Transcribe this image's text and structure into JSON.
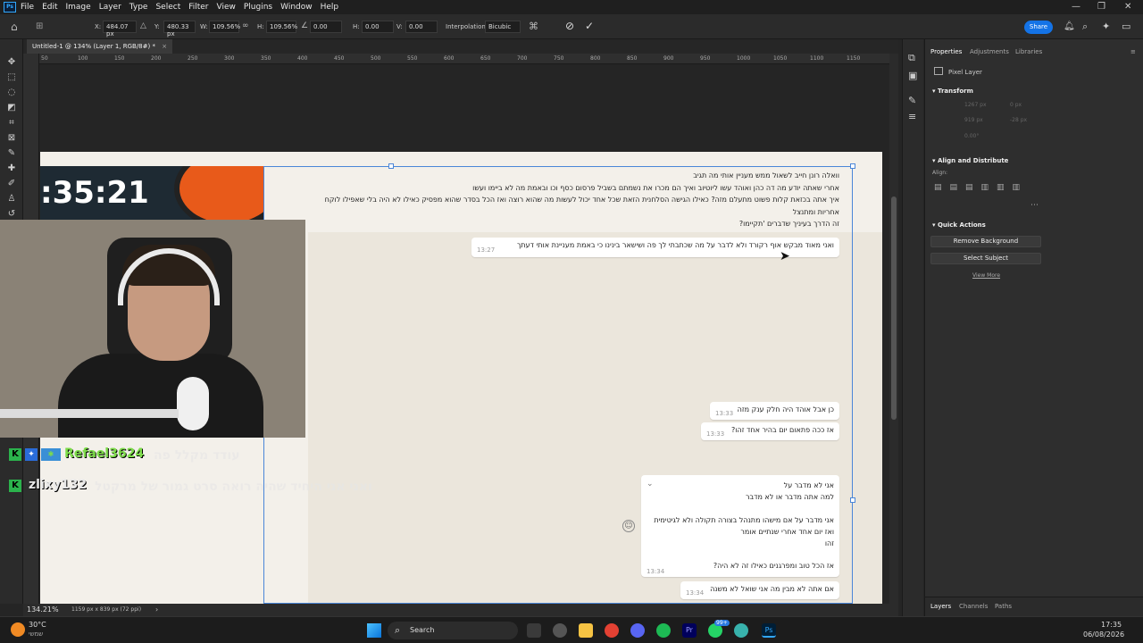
{
  "menubar": {
    "logo": "Ps",
    "items": [
      "File",
      "Edit",
      "Image",
      "Layer",
      "Type",
      "Select",
      "Filter",
      "View",
      "Plugins",
      "Window",
      "Help"
    ]
  },
  "options": {
    "x_label": "X:",
    "x_value": "484.07 px",
    "y_label": "Y:",
    "y_value": "480.33 px",
    "w_label": "W:",
    "w_value": "109.56%",
    "h_label": "H:",
    "h_value": "109.56%",
    "angle_value": "0.00",
    "hskew_label": "H:",
    "hskew_value": "0.00",
    "vskew_label": "V:",
    "vskew_value": "0.00",
    "interp_label": "Interpolation:",
    "interp_value": "Bicubic",
    "share_label": "Share"
  },
  "document": {
    "tab_title": "Untitled-1 @ 134% (Layer 1, RGB/8#) *",
    "zoom": "134.21%",
    "doc_info": "1159 px x 839 px (72 ppi)"
  },
  "canvas": {
    "clock_text": ":35:21",
    "top_message_lines": [
      "וואלה רונן חייב לשאול ממש מעניין אותי מה תגיב",
      "אחרי שאתה יודע מה דה כהן ואוהד עשו ליוטיוב ואיך הם מכרו את נשמתם בשביל פרסום כסף וכו ובאמת מה לא ביימו ועשו",
      "איך אתה בכזאת קלות פשוט מתעלם מזה? כאילו הגישה הסלחנית הזאת שכל אחד יכול לעשות מה שהוא רוצה ואז הכל בסדר שהוא מפסיק כאילו לא היה בלי שאפילו לוקח",
      "אחריות ומתנצל",
      "זה הדרך בעיניך שדברים 'תקיימו?"
    ],
    "msg2_text": "ואני מאוד מבקש אוף רקורד ולא לדבר על מה שכתבתי לך פה ושישאר בינינו כי באמת מעניינת אותי דעתך",
    "msg2_time": "13:27",
    "msg3_text": "כן אבל אוהד היה חלק ענק מזה",
    "msg3_time": "13:33",
    "msg4_text": "אז ככה פתאום יום בהיר אחד זהו?",
    "msg4_time": "13:33",
    "msg5_lines": [
      "אני לא מדבר על",
      "למה אתה מדבר או לא מדבר",
      "",
      "אני מדבר על אם מישהו מתנהל בצורה תקולה ולא לגיטימית",
      "ואז יום אחד אחרי שנתיים אומר",
      "זהו"
    ],
    "msg5_extra": "אז הכל טוב ומפרגנים כאילו זה לא היה?",
    "msg5_time": "13:34",
    "msg6_text": "אם אתה לא מבין מה אני שואל לא משנה",
    "msg6_time": "13:34"
  },
  "stream_chat": {
    "line1_user": "Refael3624",
    "line1_msg": "עודד מקלל פה",
    "line2_user": "zlixy132",
    "line2_msg": "ואני אני היחיד שהיה רואה סרט גמור של מרקטל"
  },
  "panel": {
    "tabs": [
      "Properties",
      "Adjustments",
      "Libraries"
    ],
    "layer_type": "Pixel Layer",
    "transform_label": "Transform",
    "transform_w": "1267 px",
    "transform_h": "919 px",
    "transform_x": "0 px",
    "transform_y": "-28 px",
    "transform_angle": "0.00°",
    "align_label": "Align and Distribute",
    "align_sub": "Align:",
    "quick_actions_label": "Quick Actions",
    "remove_bg": "Remove Background",
    "select_subject": "Select Subject",
    "view_more": "View More",
    "bottom_tabs": [
      "Layers",
      "Channels",
      "Paths"
    ]
  },
  "taskbar": {
    "weather_temp": "30°C",
    "weather_desc": "שמשי",
    "search_label": "Search",
    "badge": "99+",
    "time": "17:35",
    "date": "06/08/2026"
  },
  "ruler_ticks": [
    "50",
    "100",
    "150",
    "200",
    "250",
    "300",
    "350",
    "400",
    "450",
    "500",
    "550",
    "600",
    "650",
    "700",
    "750",
    "800",
    "850",
    "900",
    "950",
    "1000",
    "1050",
    "1100",
    "1150"
  ],
  "colors": {
    "accent": "#1473e6",
    "selection": "#4a86d8",
    "chat_green": "#7ddc4a",
    "chat_user2": "#e8e8e8"
  }
}
